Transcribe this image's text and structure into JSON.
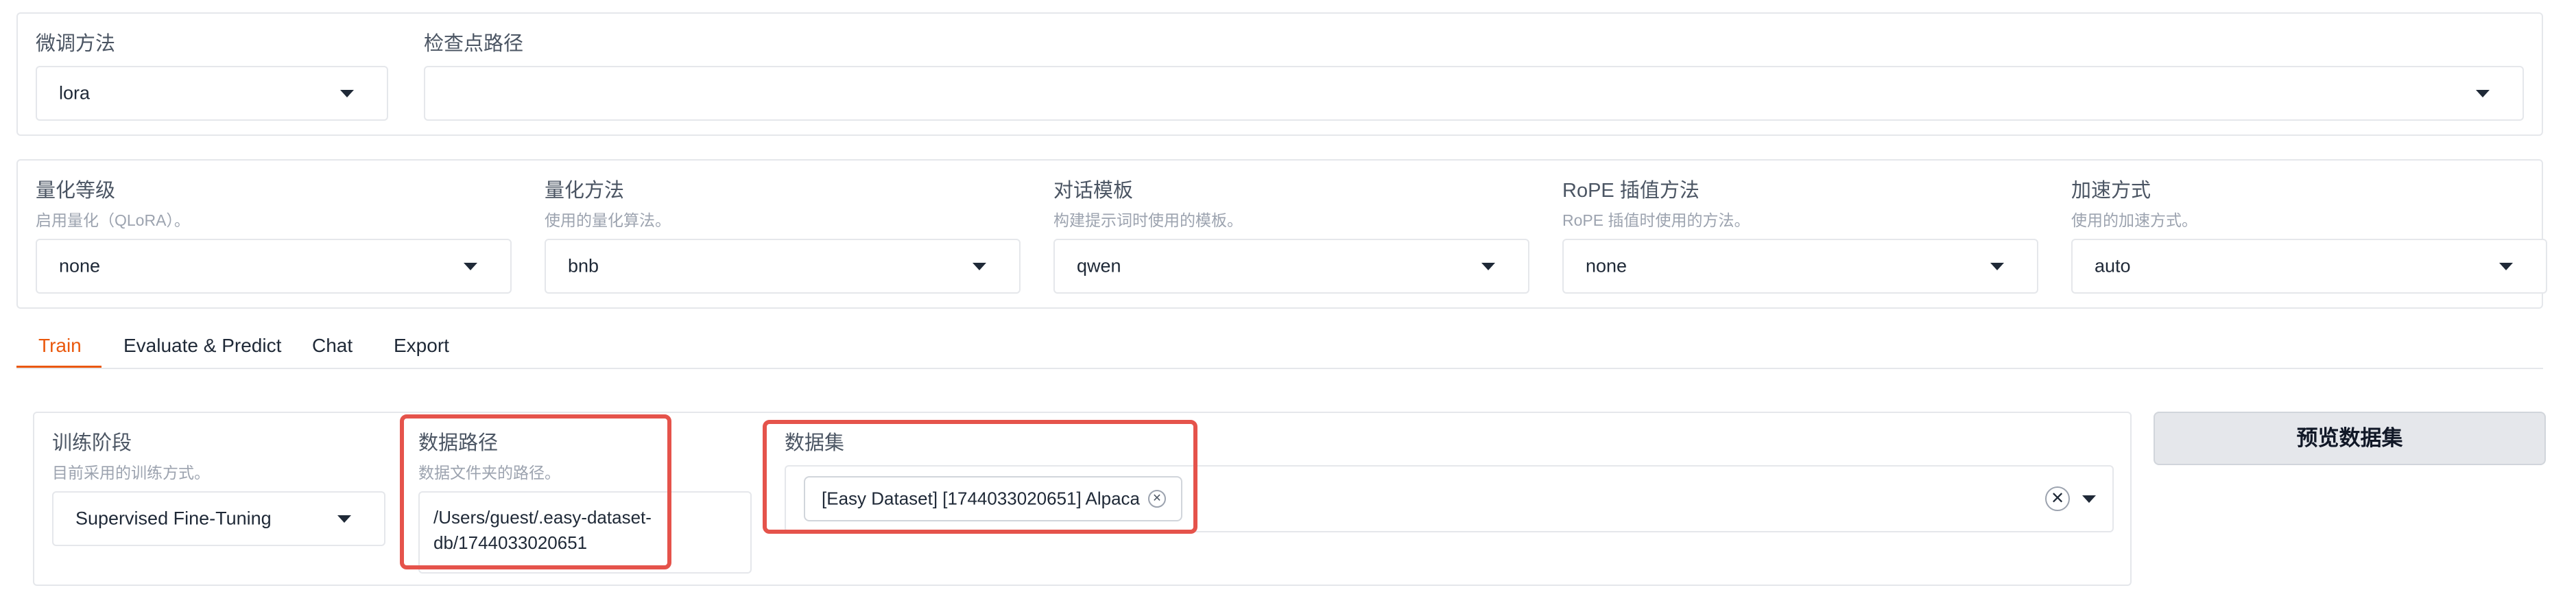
{
  "top": {
    "finetune_method": {
      "label": "微调方法",
      "value": "lora"
    },
    "checkpoint_path": {
      "label": "检查点路径",
      "value": ""
    }
  },
  "advanced": {
    "quantization_bit": {
      "label": "量化等级",
      "info": "启用量化（QLoRA）。",
      "value": "none"
    },
    "quantization_method": {
      "label": "量化方法",
      "info": "使用的量化算法。",
      "value": "bnb"
    },
    "template": {
      "label": "对话模板",
      "info": "构建提示词时使用的模板。",
      "value": "qwen"
    },
    "rope_scaling": {
      "label": "RoPE 插值方法",
      "info": "RoPE 插值时使用的方法。",
      "value": "none"
    },
    "booster": {
      "label": "加速方式",
      "info": "使用的加速方式。",
      "value": "auto"
    }
  },
  "tabs": [
    {
      "label": "Train",
      "active": true
    },
    {
      "label": "Evaluate & Predict",
      "active": false
    },
    {
      "label": "Chat",
      "active": false
    },
    {
      "label": "Export",
      "active": false
    }
  ],
  "train": {
    "stage": {
      "label": "训练阶段",
      "info": "目前采用的训练方式。",
      "value": "Supervised Fine-Tuning"
    },
    "dataset_dir": {
      "label": "数据路径",
      "info": "数据文件夹的路径。",
      "value": "/Users/guest/.easy-dataset-db/1744033020651"
    },
    "dataset": {
      "label": "数据集",
      "chips": [
        "[Easy Dataset] [1744033020651] Alpaca"
      ]
    },
    "preview_button": "预览数据集"
  },
  "colors": {
    "accent": "#ea580c",
    "highlight": "#e5534b",
    "border": "#e5e7eb",
    "button_bg": "#e5e7eb"
  },
  "icons": {
    "dropdown": "chevron-down-icon",
    "remove": "close-icon"
  }
}
